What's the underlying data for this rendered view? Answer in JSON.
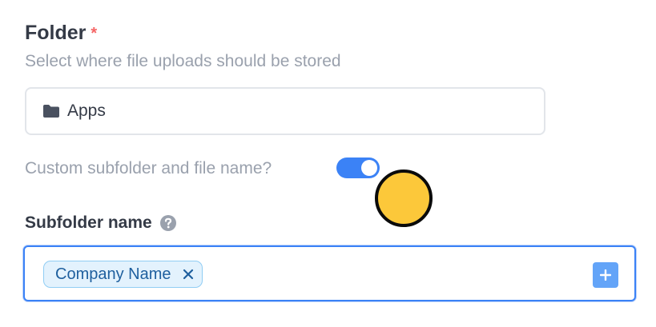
{
  "folder": {
    "label": "Folder",
    "required_mark": "*",
    "help_text": "Select where file uploads should be stored",
    "selected_value": "Apps",
    "icon": "folder-icon"
  },
  "custom_subfolder": {
    "label": "Custom subfolder and file name?",
    "enabled": true
  },
  "subfolder": {
    "label": "Subfolder name",
    "help_icon": "question-circle-icon",
    "tokens": [
      "Company Name"
    ],
    "add_icon": "plus-icon"
  },
  "colors": {
    "accent": "#3b82f6",
    "required": "#f56565",
    "chip_bg": "#e3f2fd",
    "chip_text": "#1e5f9e",
    "cursor_marker": "#fcc83a"
  }
}
